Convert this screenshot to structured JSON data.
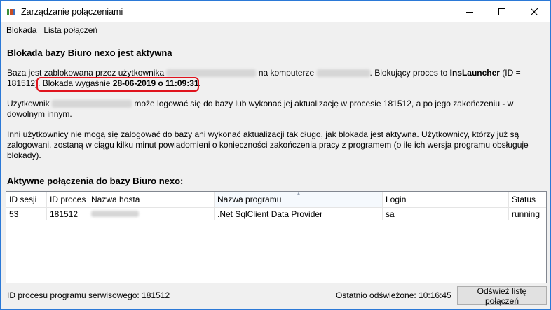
{
  "window": {
    "title": "Zarządzanie połączeniami",
    "icon_colors": [
      "#3b8f3b",
      "#c94d24",
      "#3b6fbf"
    ]
  },
  "menu": {
    "items": [
      "Blokada",
      "Lista połączeń"
    ]
  },
  "lock": {
    "heading": "Blokada bazy Biuro nexo jest aktywna",
    "p1_a": "Baza jest zablokowana przez użytkownika",
    "p1_b": "na komputerze",
    "p1_c": ". Blokujący proces to ",
    "process_name": "InsLauncher",
    "p1_d": " (ID =",
    "p1_e": "181512).",
    "expiry_prefix": "Blokada wygaśnie ",
    "expiry_value": "28-06-2019 o 11:09:31.",
    "p2_a": "Użytkownik",
    "p2_b": "może logować się do bazy lub wykonać jej aktualizację w procesie 181512, a po jego zakończeniu - w",
    "p2_c": "dowolnym innym.",
    "p3_a": "Inni użytkownicy nie mogą się zalogować do bazy ani wykonać aktualizacji tak długo, jak blokada jest aktywna. Użytkownicy, którzy już są",
    "p3_b": "zalogowani, zostaną w ciągu kilku minut powiadomieni o konieczności zakończenia pracy z programem (o ile ich wersja programu obsługuje",
    "p3_c": "blokady)."
  },
  "connections": {
    "heading": "Aktywne połączenia do bazy Biuro nexo:",
    "columns": [
      "ID sesji",
      "ID proces",
      "Nazwa hosta",
      "Nazwa programu",
      "Login",
      "Status"
    ],
    "rows": [
      {
        "session": "53",
        "process": "181512",
        "host": "",
        "program": ".Net SqlClient Data Provider",
        "login": "sa",
        "status": "running"
      }
    ]
  },
  "status": {
    "service_process": "ID procesu programu serwisowego: 181512",
    "last_refresh": "Ostatnio odświeżone: 10:16:45",
    "refresh_button": "Odśwież listę połączeń"
  },
  "colors": {
    "title_border": "#2b79d7",
    "highlight": "#e0141e"
  }
}
